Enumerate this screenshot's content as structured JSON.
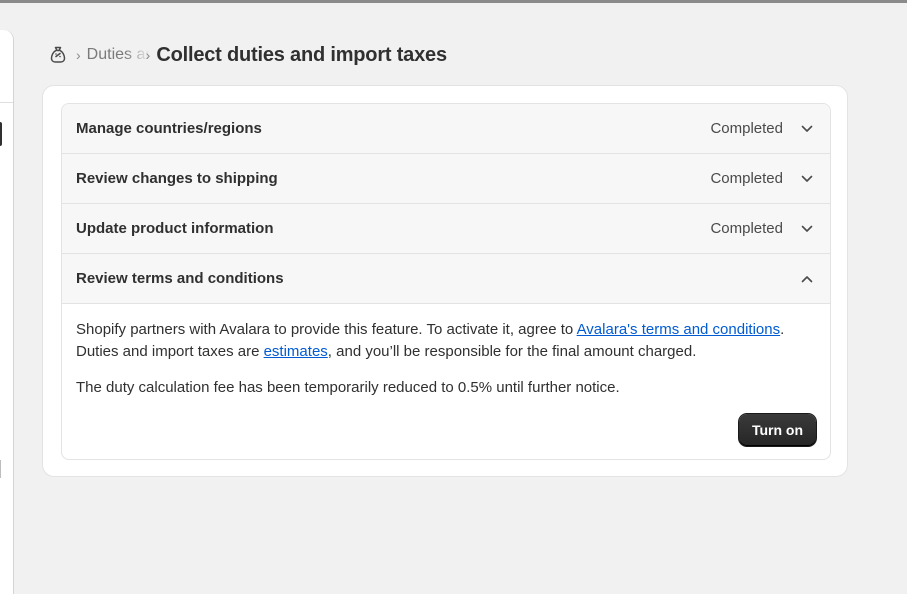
{
  "breadcrumb": {
    "icon": "money-bag-icon",
    "parent_label": "Duties and import taxes",
    "page_title": "Collect duties and import taxes"
  },
  "accordion": {
    "items": [
      {
        "title": "Manage countries/regions",
        "status": "Completed",
        "expanded": false
      },
      {
        "title": "Review changes to shipping",
        "status": "Completed",
        "expanded": false
      },
      {
        "title": "Update product information",
        "status": "Completed",
        "expanded": false
      },
      {
        "title": "Review terms and conditions",
        "status": "",
        "expanded": true
      }
    ],
    "terms_panel": {
      "text_before_link": "Shopify partners with Avalara to provide this feature. To activate it, agree to ",
      "terms_link": "Avalara's terms and conditions",
      "text_middle": ". Duties and import taxes are ",
      "estimates_link": "estimates",
      "text_after": ", and you’ll be responsible for the final amount charged.",
      "fee_notice": "The duty calculation fee has been temporarily reduced to 0.5% until further notice.",
      "turn_on_label": "Turn on"
    }
  },
  "colors": {
    "link": "#005bd3",
    "primary_button": "#303030",
    "background": "#f1f1f1"
  }
}
